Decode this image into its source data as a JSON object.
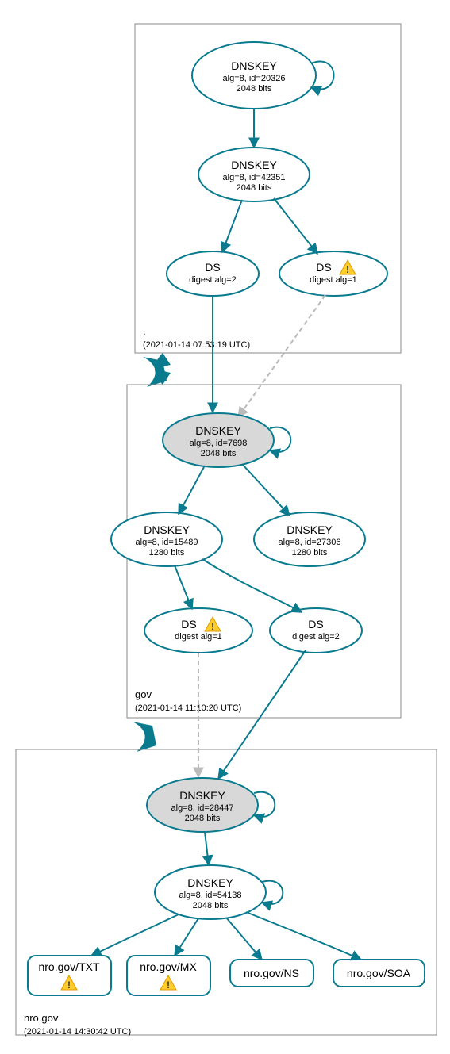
{
  "zones": {
    "root": {
      "label": ".",
      "time": "(2021-01-14 07:53:19 UTC)"
    },
    "gov": {
      "label": "gov",
      "time": "(2021-01-14 11:10:20 UTC)"
    },
    "nro": {
      "label": "nro.gov",
      "time": "(2021-01-14 14:30:42 UTC)"
    }
  },
  "nodes": {
    "root_ksk": {
      "title": "DNSKEY",
      "alg": "alg=8, id=20326",
      "bits": "2048 bits"
    },
    "root_zsk": {
      "title": "DNSKEY",
      "alg": "alg=8, id=42351",
      "bits": "2048 bits"
    },
    "root_ds1": {
      "title": "DS",
      "sub": "digest alg=2"
    },
    "root_ds2": {
      "title": "DS",
      "sub": "digest alg=1"
    },
    "gov_ksk": {
      "title": "DNSKEY",
      "alg": "alg=8, id=7698",
      "bits": "2048 bits"
    },
    "gov_zsk1": {
      "title": "DNSKEY",
      "alg": "alg=8, id=15489",
      "bits": "1280 bits"
    },
    "gov_zsk2": {
      "title": "DNSKEY",
      "alg": "alg=8, id=27306",
      "bits": "1280 bits"
    },
    "gov_ds1": {
      "title": "DS",
      "sub": "digest alg=1"
    },
    "gov_ds2": {
      "title": "DS",
      "sub": "digest alg=2"
    },
    "nro_ksk": {
      "title": "DNSKEY",
      "alg": "alg=8, id=28447",
      "bits": "2048 bits"
    },
    "nro_zsk": {
      "title": "DNSKEY",
      "alg": "alg=8, id=54138",
      "bits": "2048 bits"
    },
    "rr_txt": "nro.gov/TXT",
    "rr_mx": "nro.gov/MX",
    "rr_ns": "nro.gov/NS",
    "rr_soa": "nro.gov/SOA"
  }
}
